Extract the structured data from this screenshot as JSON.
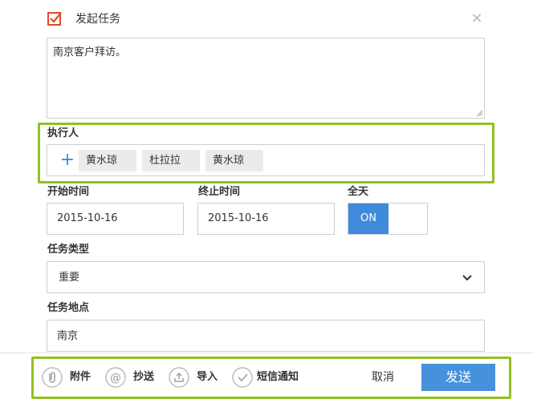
{
  "header": {
    "title": "发起任务",
    "close_label": "×"
  },
  "description": {
    "value": "南京客户拜访。"
  },
  "executors": {
    "label": "执行人",
    "add_label": "+",
    "people": [
      "黄水琼",
      "杜拉拉",
      "黄水琼"
    ]
  },
  "start": {
    "label": "开始时间",
    "value": "2015-10-16"
  },
  "end": {
    "label": "终止时间",
    "value": "2015-10-16"
  },
  "all_day": {
    "label": "全天",
    "state": "ON"
  },
  "task_type": {
    "label": "任务类型",
    "value": "重要"
  },
  "location": {
    "label": "任务地点",
    "value": "南京"
  },
  "footer": {
    "attachment": "附件",
    "cc": "抄送",
    "import": "导入",
    "sms": "短信通知",
    "cancel": "取消",
    "send": "发送"
  },
  "colors": {
    "accent": "#4791dc",
    "highlight": "#93c01f",
    "header_icon": "#e04a2a"
  }
}
